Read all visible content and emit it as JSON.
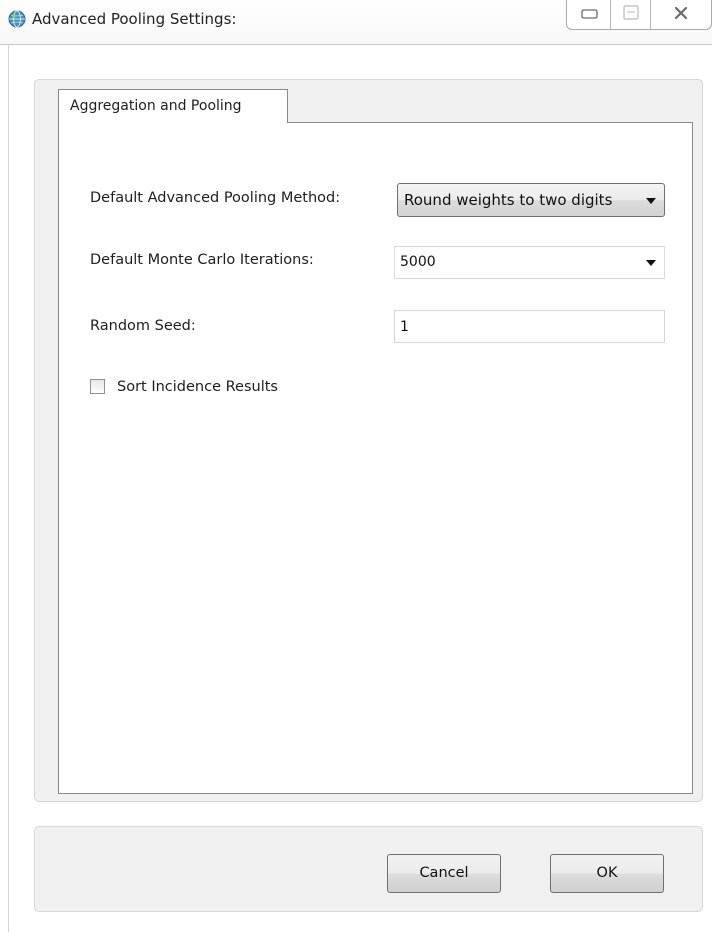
{
  "window": {
    "title": "Advanced Pooling Settings:",
    "icon": "globe-icon",
    "controls": {
      "minimize": "minimize-icon",
      "maximize": "maximize-icon",
      "close": "close-icon"
    }
  },
  "tabs": [
    {
      "label": "Aggregation and Pooling",
      "selected": true
    }
  ],
  "settings": {
    "pooling_method": {
      "label": "Default Advanced Pooling Method:",
      "value": "Round weights to two digits"
    },
    "monte_carlo": {
      "label": "Default Monte Carlo Iterations:",
      "value": "5000"
    },
    "random_seed": {
      "label": "Random Seed:",
      "value": "1"
    },
    "sort_incidence": {
      "label": "Sort Incidence Results",
      "checked": false
    }
  },
  "buttons": {
    "cancel": "Cancel",
    "ok": "OK"
  }
}
